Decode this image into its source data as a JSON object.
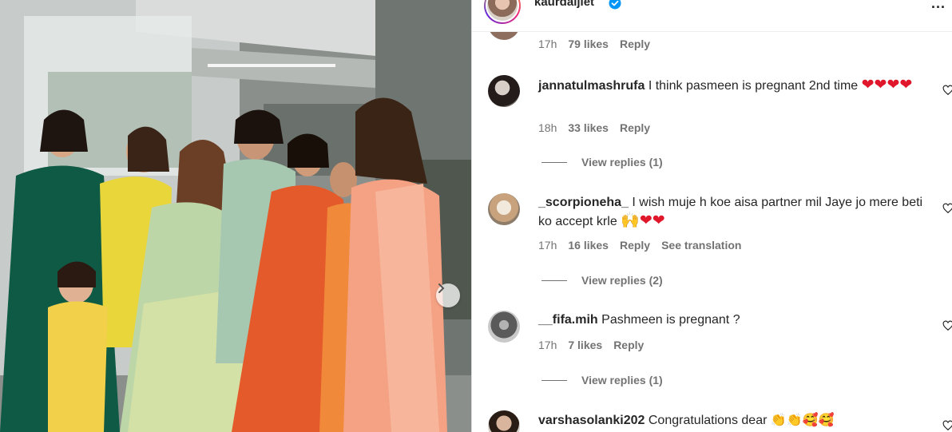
{
  "post": {
    "username": "kaurdaljiet",
    "more_label": "..."
  },
  "photo": {
    "next_label": "›"
  },
  "comments": [
    {
      "username": "",
      "text": "",
      "time": "17h",
      "likes": "79 likes",
      "reply": "Reply"
    },
    {
      "username": "jannatulmashrufa",
      "text": "I think pasmeen is pregnant 2nd time",
      "emoji": "❤❤❤❤",
      "time": "18h",
      "likes": "33 likes",
      "reply": "Reply",
      "view_replies": "View replies (1)"
    },
    {
      "username": "_scorpioneha_",
      "text": "I wish muje h koe aisa partner mil Jaye jo mere beti ko accept krle",
      "emoji": "🙌❤❤",
      "time": "17h",
      "likes": "16 likes",
      "reply": "Reply",
      "translation": "See translation",
      "view_replies": "View replies (2)"
    },
    {
      "username": "__fifa.mih",
      "text": "Pashmeen is pregnant ?",
      "time": "17h",
      "likes": "7 likes",
      "reply": "Reply",
      "view_replies": "View replies (1)"
    },
    {
      "username": "varshasolanki202",
      "text": "Congratulations dear",
      "emoji": "👏👏🥰🥰"
    }
  ],
  "colors": {
    "text": "#262626",
    "secondary": "#737373",
    "verified": "#0095f6",
    "heart": "#e0162b"
  }
}
